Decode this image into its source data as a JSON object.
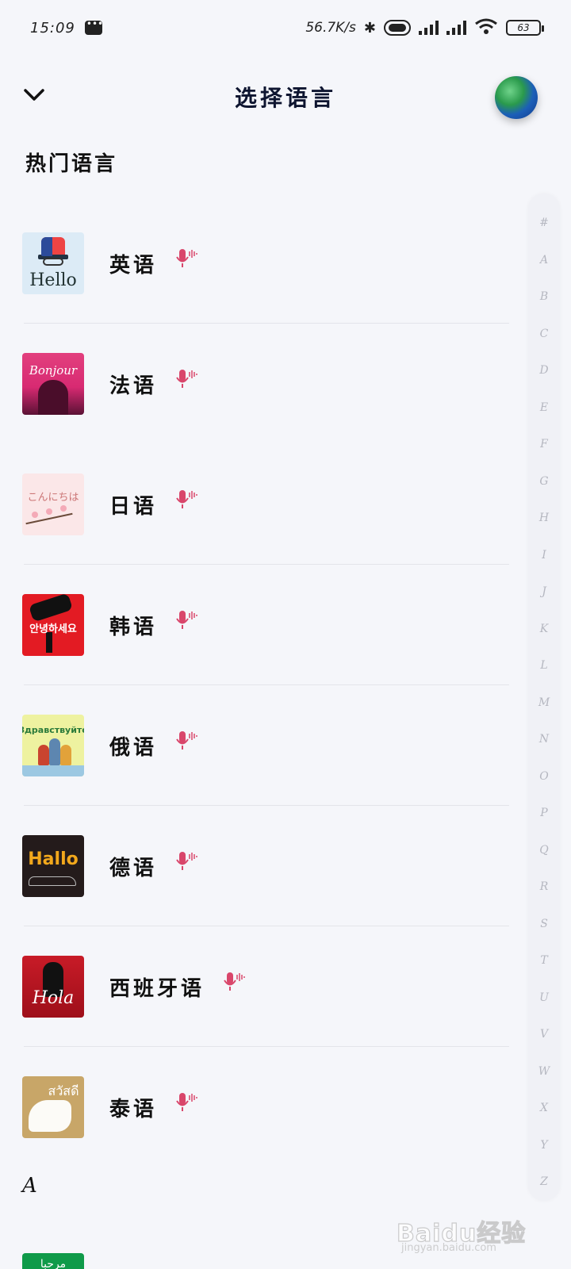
{
  "status_bar": {
    "time": "15:09",
    "network_speed": "56.7K/s",
    "hd_label": "HD",
    "battery": "63"
  },
  "header": {
    "title": "选择语言"
  },
  "sections": {
    "hot_label": "热门语言",
    "a_label": "A"
  },
  "languages": [
    {
      "name": "英语",
      "thumb_text": "Hello",
      "thumb": "english-thumb"
    },
    {
      "name": "法语",
      "thumb_text": "Bonjour",
      "thumb": "french-thumb"
    },
    {
      "name": "日语",
      "thumb_text": "こんにちは",
      "thumb": "japanese-thumb"
    },
    {
      "name": "韩语",
      "thumb_text": "안녕하세요",
      "thumb": "korean-thumb"
    },
    {
      "name": "俄语",
      "thumb_text": "Здравствуйте",
      "thumb": "russian-thumb"
    },
    {
      "name": "德语",
      "thumb_text": "Hallo",
      "thumb": "german-thumb"
    },
    {
      "name": "西班牙语",
      "thumb_text": "Hola",
      "thumb": "spanish-thumb"
    },
    {
      "name": "泰语",
      "thumb_text": "สวัสดี",
      "thumb": "thai-thumb"
    }
  ],
  "partial_row": {
    "thumb_text": "مرحبا"
  },
  "index_letters": [
    "#",
    "A",
    "B",
    "C",
    "D",
    "E",
    "F",
    "G",
    "H",
    "I",
    "J",
    "K",
    "L",
    "M",
    "N",
    "O",
    "P",
    "Q",
    "R",
    "S",
    "T",
    "U",
    "V",
    "W",
    "X",
    "Y",
    "Z"
  ],
  "watermark": {
    "text": "Baidu经验",
    "sub": "jingyan.baidu.com"
  },
  "colors": {
    "background": "#f5f6fa",
    "mic_accent": "#d9466b",
    "title": "#0e1530"
  }
}
